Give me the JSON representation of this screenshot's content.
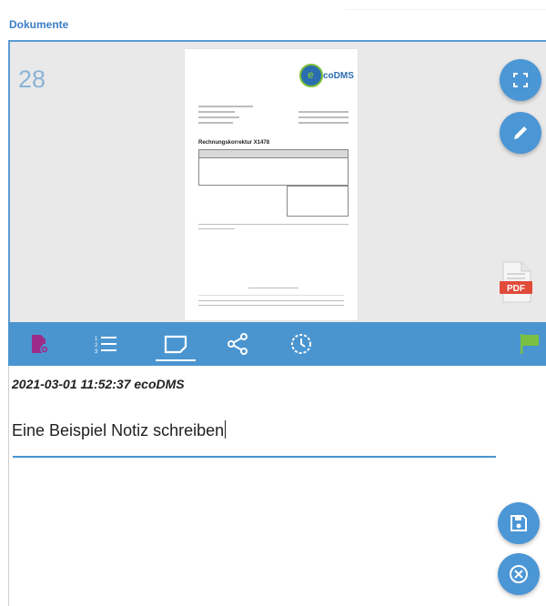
{
  "header": {
    "section_title": "Dokumente"
  },
  "document": {
    "number": "28",
    "preview": {
      "logo_text": "coDMS",
      "logo_letter": "e",
      "heading": "Rechnungskorrektur X1478"
    },
    "file_type_label": "PDF"
  },
  "toolbar": {
    "items": [
      {
        "name": "document-settings-icon",
        "active": false
      },
      {
        "name": "numbered-list-icon",
        "active": false
      },
      {
        "name": "note-icon",
        "active": true
      },
      {
        "name": "share-icon",
        "active": false
      },
      {
        "name": "history-icon",
        "active": false
      },
      {
        "name": "flag-icon",
        "active": false
      }
    ]
  },
  "note": {
    "meta": "2021-03-01 11:52:37 ecoDMS",
    "text": "Eine Beispiel Notiz schreiben"
  },
  "colors": {
    "accent": "#4a95d0",
    "title": "#3b7dc4",
    "flag": "#7ac143",
    "settings_icon": "#9b2d88",
    "pdf": "#e04b3a"
  }
}
